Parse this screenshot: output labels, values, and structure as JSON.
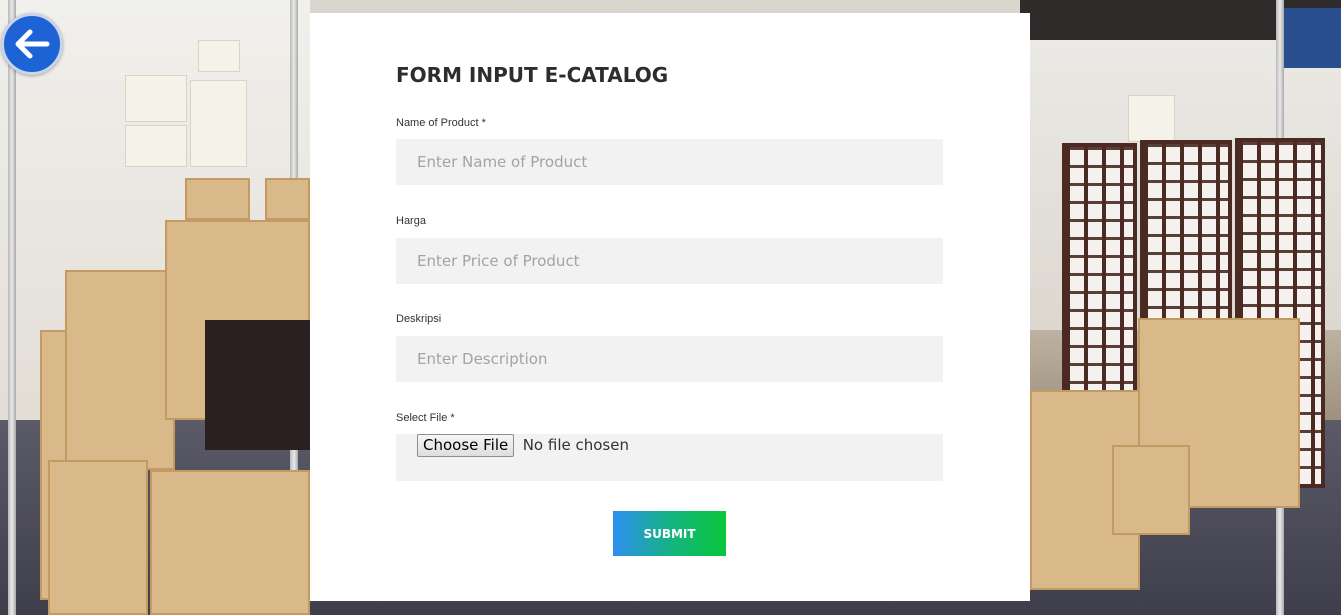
{
  "back_button": {
    "icon": "arrow-left-icon"
  },
  "form": {
    "title": "FORM INPUT E-CATALOG",
    "fields": [
      {
        "label": "Name of Product *",
        "value": "",
        "placeholder": "Enter Name of Product"
      },
      {
        "label": "Harga",
        "value": "",
        "placeholder": "Enter Price of Product"
      },
      {
        "label": "Deskripsi",
        "value": "",
        "placeholder": "Enter Description"
      }
    ],
    "file": {
      "label": "Select File *",
      "button_label": "Choose File",
      "status": "No file chosen"
    },
    "submit_label": "SUBMIT"
  },
  "colors": {
    "back_button": "#1e63d6",
    "input_background": "#f2f2f2",
    "submit_gradient_start": "#2f8ff1",
    "submit_gradient_end": "#0ac63a",
    "card_background": "#ffffff"
  }
}
